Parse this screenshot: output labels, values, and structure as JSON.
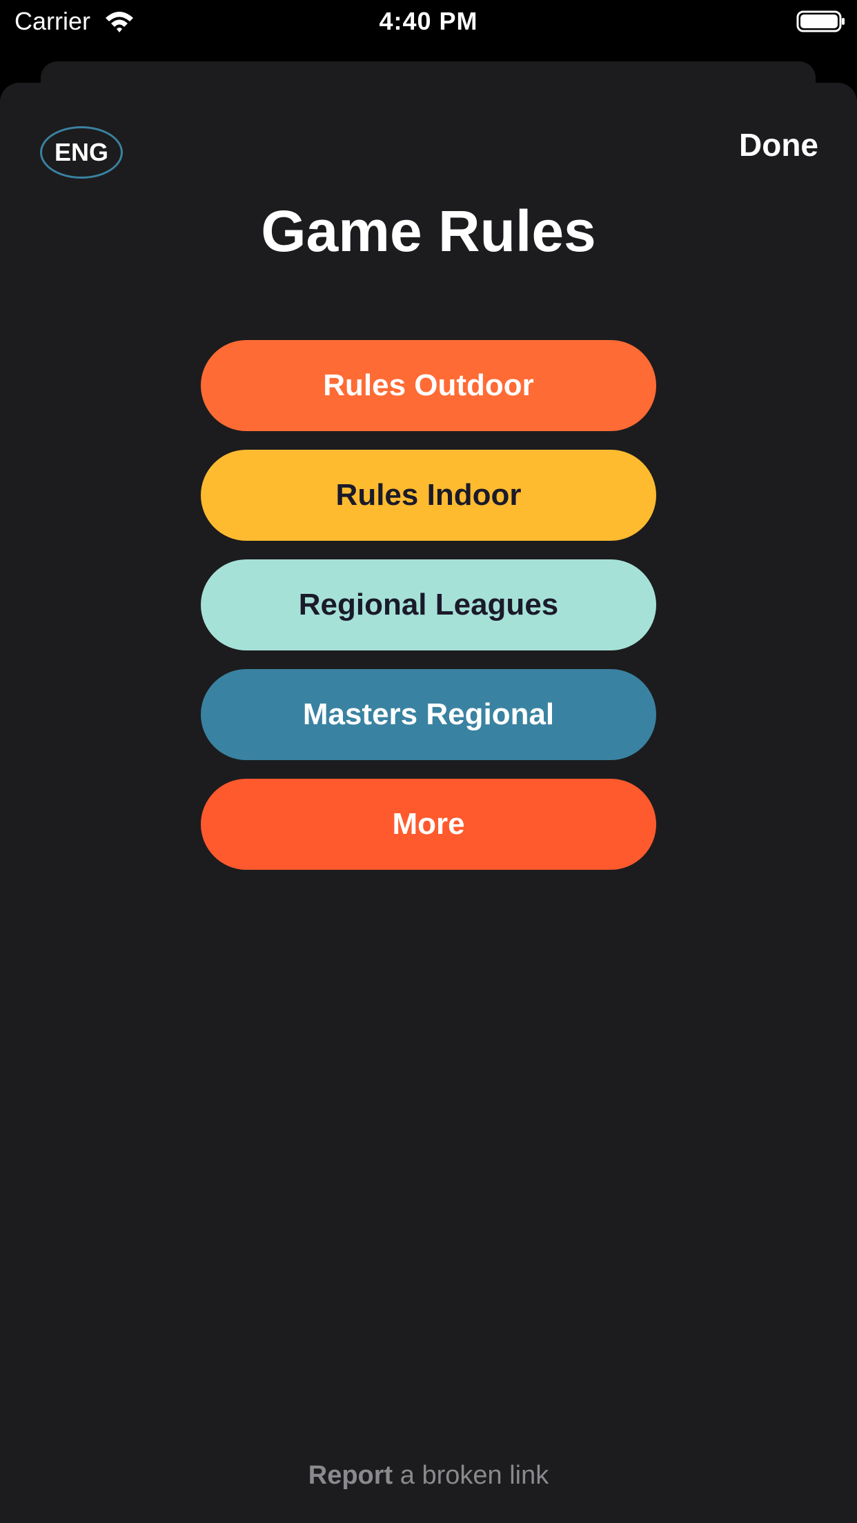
{
  "status_bar": {
    "carrier": "Carrier",
    "time": "4:40 PM",
    "wifi_icon": "wifi-icon",
    "battery_icon": "battery-full-icon"
  },
  "header": {
    "language": "ENG",
    "language_border_color": "#3a82a1",
    "done_label": "Done",
    "title": "Game Rules"
  },
  "menu": {
    "items": [
      {
        "label": "Rules Outdoor",
        "background": "#ff6b35",
        "text_color": "#ffffff"
      },
      {
        "label": "Rules Indoor",
        "background": "#ffbb30",
        "text_color": "#1a1a2a"
      },
      {
        "label": "Regional Leagues",
        "background": "#a6e1d8",
        "text_color": "#1a1a2a"
      },
      {
        "label": "Masters Regional",
        "background": "#3a82a1",
        "text_color": "#ffffff"
      },
      {
        "label": "More",
        "background": "#ff5a2e",
        "text_color": "#ffffff"
      }
    ]
  },
  "footer": {
    "report_strong": "Report",
    "report_rest": " a broken link"
  },
  "colors": {
    "background": "#1c1c1e",
    "status_bar_bg": "#000000"
  }
}
